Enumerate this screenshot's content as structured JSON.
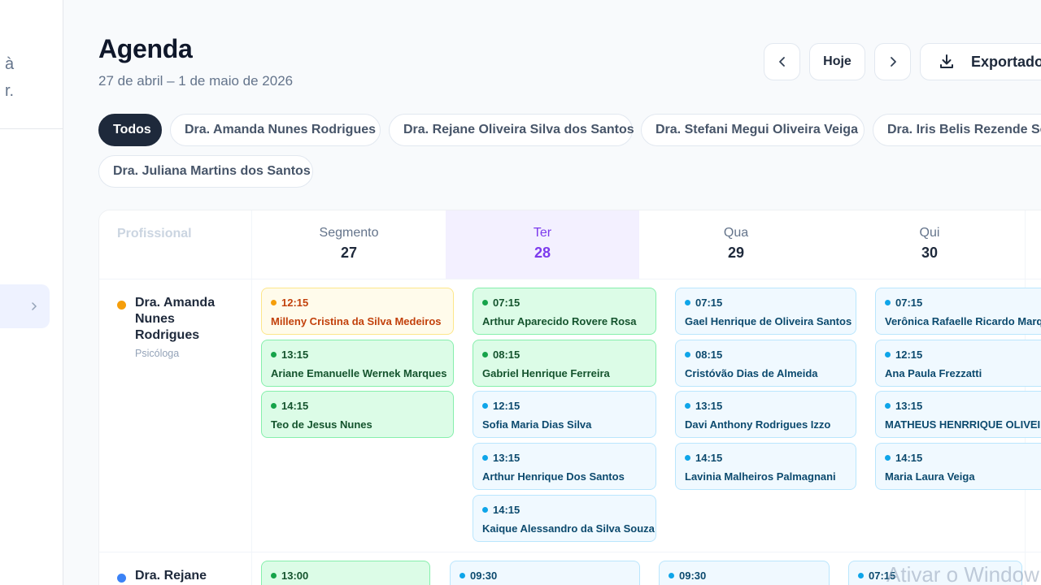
{
  "sidebar": {
    "line1": "à",
    "line2": "r."
  },
  "header": {
    "title": "Agenda",
    "subtitle": "27 de abril – 1 de maio de 2026",
    "today_label": "Hoje",
    "export_label": "Exportado"
  },
  "filters": [
    "Todos",
    "Dra. Amanda Nunes Rodrigues",
    "Dra. Rejane Oliveira Silva dos Santos",
    "Dra. Stefani Megui Oliveira Veiga",
    "Dra. Iris Belis Rezende Soa",
    "Dra. Juliana Martins dos Santos"
  ],
  "calendar": {
    "prof_header": "Profissional",
    "days": [
      {
        "name": "Segmento",
        "num": "27"
      },
      {
        "name": "Ter",
        "num": "28"
      },
      {
        "name": "Qua",
        "num": "29"
      },
      {
        "name": "Qui",
        "num": "30"
      }
    ],
    "professionals": [
      {
        "name": "Dra. Amanda Nunes Rodrigues",
        "role": "Psicóloga",
        "color": "#f59e0b"
      },
      {
        "name": "Dra. Rejane Oliveira Si",
        "color": "#3b82f6"
      }
    ],
    "row1": {
      "seg": [
        {
          "time": "12:15",
          "patient": "Milleny Cristina da Silva Medeiros",
          "status": "yellow"
        },
        {
          "time": "13:15",
          "patient": "Ariane Emanuelle Wernek Marques",
          "status": "green"
        },
        {
          "time": "14:15",
          "patient": "Teo de Jesus Nunes",
          "status": "green"
        }
      ],
      "ter": [
        {
          "time": "07:15",
          "patient": "Arthur Aparecido Rovere Rosa",
          "status": "green"
        },
        {
          "time": "08:15",
          "patient": "Gabriel Henrique Ferreira",
          "status": "green"
        },
        {
          "time": "12:15",
          "patient": "Sofia Maria Dias Silva",
          "status": "blue"
        },
        {
          "time": "13:15",
          "patient": "Arthur Henrique Dos Santos",
          "status": "blue"
        },
        {
          "time": "14:15",
          "patient": "Kaique Alessandro da Silva Souza",
          "status": "blue"
        }
      ],
      "qua": [
        {
          "time": "07:15",
          "patient": "Gael Henrique de Oliveira Santos",
          "status": "blue"
        },
        {
          "time": "08:15",
          "patient": "Cristóvão Dias de Almeida",
          "status": "blue"
        },
        {
          "time": "13:15",
          "patient": "Davi Anthony Rodrigues Izzo",
          "status": "blue"
        },
        {
          "time": "14:15",
          "patient": "Lavinia Malheiros Palmagnani",
          "status": "blue"
        }
      ],
      "qui": [
        {
          "time": "07:15",
          "patient": "Verônica Rafaelle Ricardo Marq",
          "status": "blue"
        },
        {
          "time": "12:15",
          "patient": "Ana Paula Frezzatti",
          "status": "blue"
        },
        {
          "time": "13:15",
          "patient": "MATHEUS HENRRIQUE OLIVEIR",
          "status": "blue"
        },
        {
          "time": "14:15",
          "patient": "Maria Laura Veiga",
          "status": "blue"
        }
      ]
    },
    "row2": [
      {
        "time": "13:00",
        "status": "green"
      },
      {
        "time": "09:30",
        "status": "blue"
      },
      {
        "time": "09:30",
        "status": "blue"
      },
      {
        "time": "07:15",
        "status": "blue"
      }
    ]
  },
  "watermark": "Ativar o Window"
}
